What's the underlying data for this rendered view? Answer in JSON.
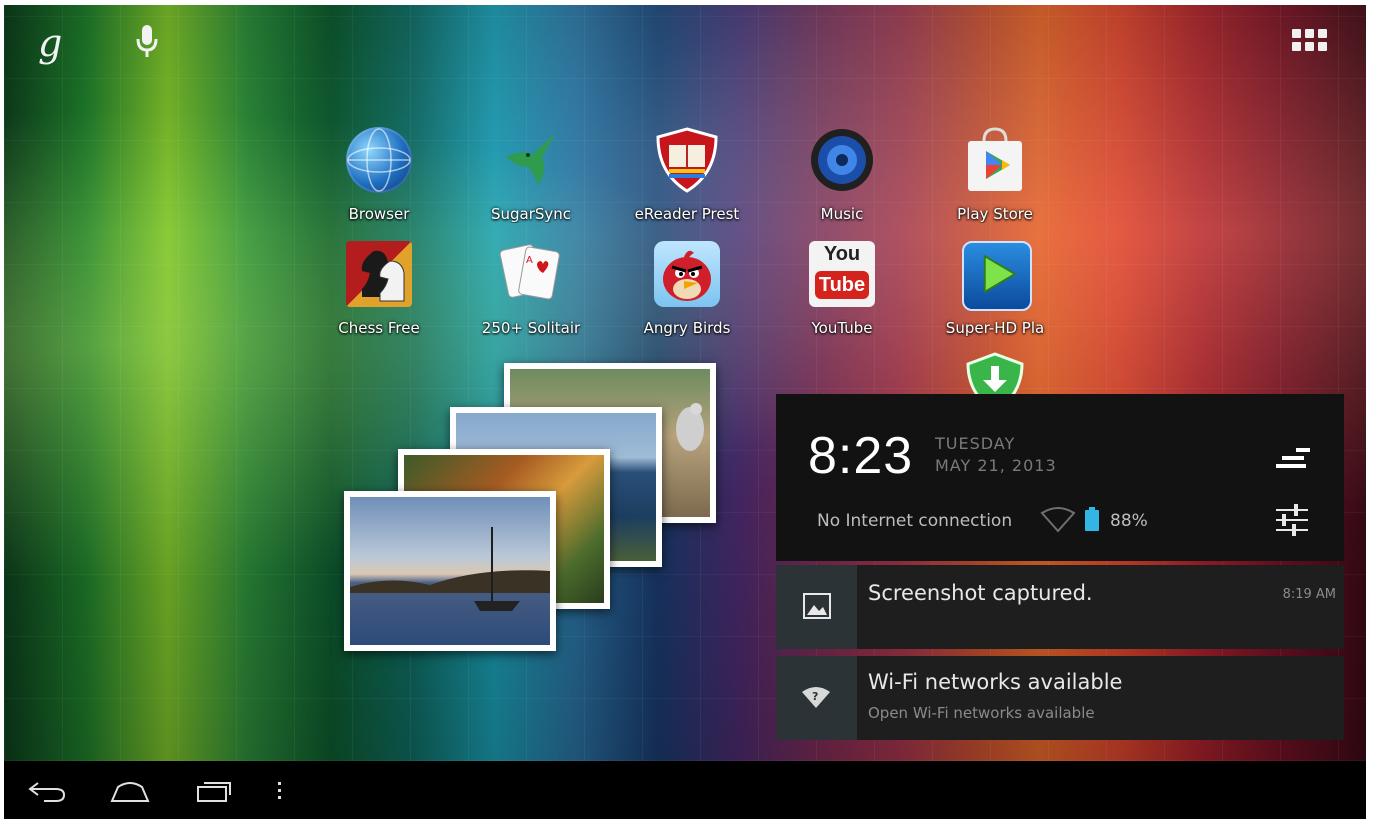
{
  "top_bar": {
    "google_search_glyph": "g",
    "mic_icon": "microphone-icon",
    "apps_icon": "all-apps-grid-icon"
  },
  "apps": [
    {
      "label": "Browser",
      "icon": "globe-icon"
    },
    {
      "label": "SugarSync",
      "icon": "hummingbird-icon"
    },
    {
      "label": "eReader Prest",
      "icon": "ereader-shield-book-icon"
    },
    {
      "label": "Music",
      "icon": "speaker-icon"
    },
    {
      "label": "Play Store",
      "icon": "play-store-bag-icon"
    },
    {
      "label": "Chess Free",
      "icon": "chess-knight-icon"
    },
    {
      "label": "250+ Solitair",
      "icon": "playing-cards-icon"
    },
    {
      "label": "Angry Birds",
      "icon": "angry-bird-icon"
    },
    {
      "label": "YouTube",
      "icon": "youtube-icon",
      "icon_text_top": "You",
      "icon_text_bottom": "Tube"
    },
    {
      "label": "Super-HD Pla",
      "icon": "video-player-icon"
    },
    {
      "label": "",
      "icon": "download-shield-icon"
    }
  ],
  "widget": {
    "photo_stack_icon": "photo-gallery-stack"
  },
  "notification_panel": {
    "time": "8:23",
    "day": "TUESDAY",
    "date": "MAY 21, 2013",
    "connection_status": "No Internet connection",
    "battery_percent": "88%",
    "clear_icon": "clear-all-icon",
    "settings_icon": "quick-settings-icon",
    "notifications": [
      {
        "title": "Screenshot captured.",
        "subtitle": "",
        "time": "8:19 AM",
        "icon": "image-icon"
      },
      {
        "title": "Wi-Fi networks available",
        "subtitle": "Open Wi-Fi networks available",
        "time": "",
        "icon": "wifi-question-icon"
      }
    ]
  },
  "nav_bar": {
    "back_icon": "back-icon",
    "home_icon": "home-icon",
    "recents_icon": "recent-apps-icon",
    "menu_icon": "overflow-menu-icon"
  },
  "colors": {
    "notification_bg": "#121212",
    "card_bg": "#1e1e1e",
    "card_icon_bg": "#2b3336",
    "battery_blue": "#33b5e5",
    "navbar_bg": "#000000"
  }
}
